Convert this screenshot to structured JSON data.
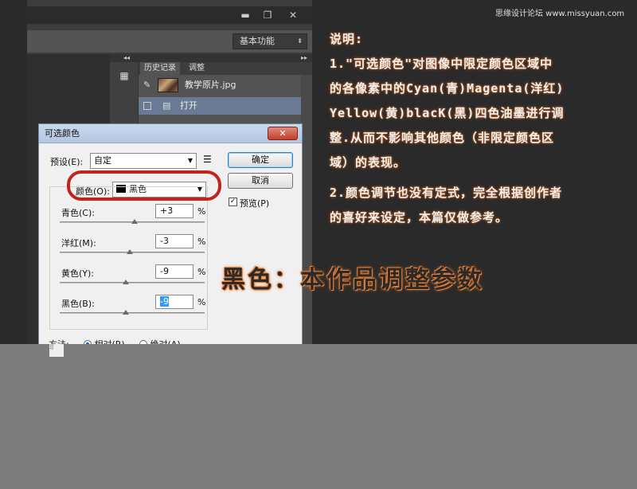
{
  "watermark": "思缘设计论坛 www.missyuan.com",
  "window": {
    "minimize": "▬",
    "restore": "❐",
    "close": "✕"
  },
  "options_bar": {
    "workspace": "基本功能"
  },
  "panel": {
    "collapse_arrows_left": "◂◂",
    "collapse_arrows_right": "▸▸",
    "tab_history": "历史记录",
    "tab_adjust": "调整",
    "history_items": [
      "教学原片.jpg",
      "打开"
    ]
  },
  "dialog": {
    "title": "可选颜色",
    "close": "✕",
    "preset_label": "预设(E):",
    "preset_value": "自定",
    "colors_label": "颜色(O):",
    "colors_value": "黑色",
    "ok": "确定",
    "cancel": "取消",
    "preview": "预览(P)",
    "sliders": [
      {
        "label": "青色(C):",
        "value": "+3",
        "unit": "%",
        "level": 3
      },
      {
        "label": "洋红(M):",
        "value": "-3",
        "unit": "%",
        "level": -3
      },
      {
        "label": "黄色(Y):",
        "value": "-9",
        "unit": "%",
        "level": -9
      },
      {
        "label": "黑色(B):",
        "value": "-9",
        "unit": "%",
        "level": -9
      }
    ],
    "method_label": "方法:",
    "method_relative": "相对(R)",
    "method_absolute": "绝对(A)"
  },
  "tutorial": {
    "heading": "说明:",
    "p1_lines": [
      "1.\"可选颜色\"对图像中限定颜色区域中",
      "的各像素中的Cyan(青)Magenta(洋红)",
      "Yellow(黄)blacK(黑)四色油墨进行调",
      "整.从而不影响其他颜色（非限定颜色区",
      "域）的表现。"
    ],
    "p2_lines": [
      "2.颜色调节也没有定式，完全根据创作者",
      "的喜好来设定，本篇仅做参考。"
    ],
    "big_title": "黑色：本作品调整参数"
  },
  "colors": {
    "accent_ring": "#c0241f",
    "glow": "#e07a30"
  }
}
